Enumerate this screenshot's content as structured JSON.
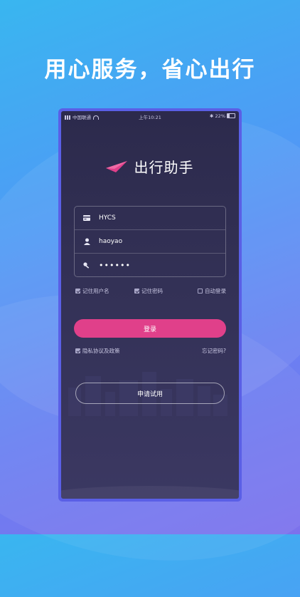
{
  "headline": "用心服务，省心出行",
  "statusbar": {
    "carrier": "中国联通",
    "time": "上午10:21",
    "battery": "22%"
  },
  "app": {
    "name": "出行助手"
  },
  "form": {
    "company_value": "HYCS",
    "username_value": "haoyao",
    "password_value": "••••••"
  },
  "options": {
    "remember_username": "记住用户名",
    "remember_password": "记住密码",
    "auto_login": "自动登录"
  },
  "login_button": "登录",
  "privacy_label": "隐私协议及政策",
  "forgot_password": "忘记密码?",
  "trial_button": "申请试用",
  "colors": {
    "accent": "#e0408a",
    "screen_bg": "#333156",
    "frame": "#5a5fe6"
  }
}
